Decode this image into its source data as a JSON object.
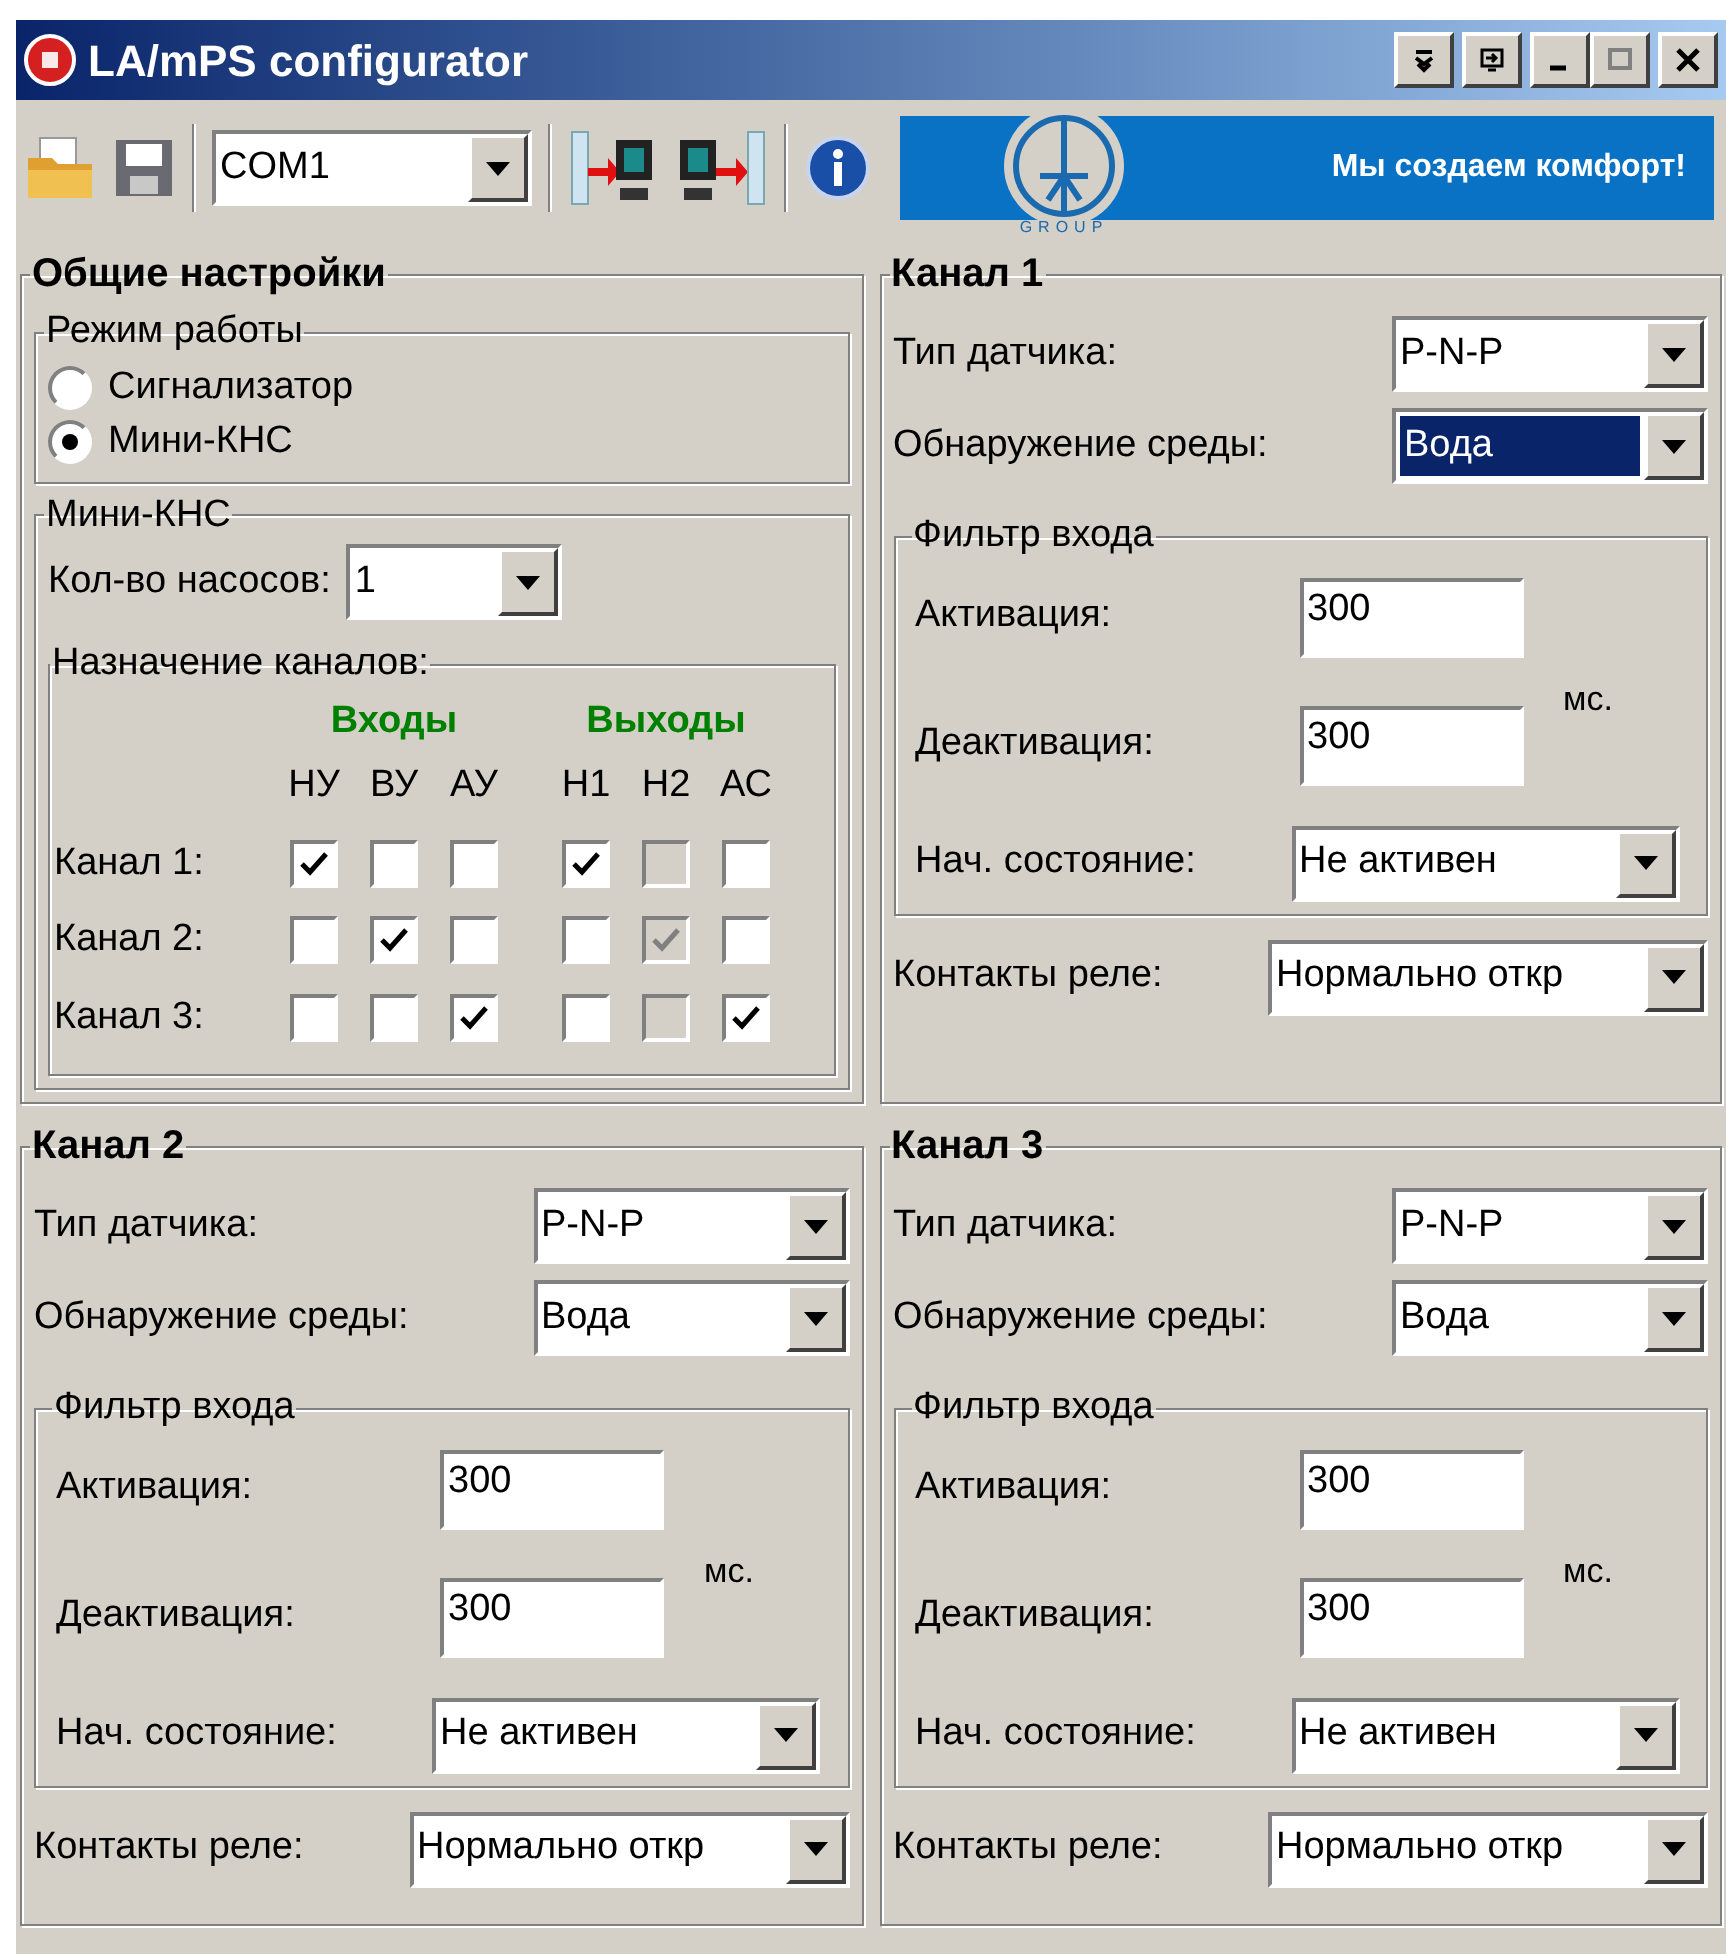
{
  "window": {
    "title": "LA/mPS configurator"
  },
  "toolbar": {
    "port": "COM1",
    "banner": {
      "caption": "GROUP",
      "slogan": "Мы создаем комфорт!"
    }
  },
  "general": {
    "title": "Общие настройки",
    "mode": {
      "title": "Режим работы",
      "options": [
        {
          "label": "Сигнализатор",
          "selected": false
        },
        {
          "label": "Мини-КНС",
          "selected": true
        }
      ]
    },
    "mini_kns": {
      "title": "Мини-КНС",
      "pumps_label": "Кол-во насосов:",
      "pumps": "1",
      "assignment": {
        "title": "Назначение каналов:",
        "groups": [
          "Входы",
          "Выходы"
        ],
        "columns": [
          "НУ",
          "ВУ",
          "АУ",
          "Н1",
          "Н2",
          "АС"
        ],
        "rows": [
          {
            "label": "Канал 1:",
            "cells": [
              {
                "checked": true,
                "disabled": false
              },
              {
                "checked": false,
                "disabled": false
              },
              {
                "checked": false,
                "disabled": false
              },
              {
                "checked": true,
                "disabled": false
              },
              {
                "checked": false,
                "disabled": true
              },
              {
                "checked": false,
                "disabled": false
              }
            ]
          },
          {
            "label": "Канал 2:",
            "cells": [
              {
                "checked": false,
                "disabled": false
              },
              {
                "checked": true,
                "disabled": false
              },
              {
                "checked": false,
                "disabled": false
              },
              {
                "checked": false,
                "disabled": false
              },
              {
                "checked": true,
                "disabled": true
              },
              {
                "checked": false,
                "disabled": false
              }
            ]
          },
          {
            "label": "Канал 3:",
            "cells": [
              {
                "checked": false,
                "disabled": false
              },
              {
                "checked": false,
                "disabled": false
              },
              {
                "checked": true,
                "disabled": false
              },
              {
                "checked": false,
                "disabled": false
              },
              {
                "checked": false,
                "disabled": true
              },
              {
                "checked": true,
                "disabled": false
              }
            ]
          }
        ]
      }
    }
  },
  "channels": [
    {
      "title": "Канал 1",
      "sensor_label": "Тип датчика:",
      "sensor": "P-N-P",
      "medium_label": "Обнаружение среды:",
      "medium": "Вода",
      "medium_focused": true,
      "filter_title": "Фильтр входа",
      "activation_label": "Активация:",
      "activation": "300",
      "deactivation_label": "Деактивация:",
      "deactivation": "300",
      "unit": "мс.",
      "initial_label": "Нач. состояние:",
      "initial": "Не активен",
      "relay_label": "Контакты реле:",
      "relay": "Нормально откр"
    },
    {
      "title": "Канал 2",
      "sensor_label": "Тип датчика:",
      "sensor": "P-N-P",
      "medium_label": "Обнаружение среды:",
      "medium": "Вода",
      "medium_focused": false,
      "filter_title": "Фильтр входа",
      "activation_label": "Активация:",
      "activation": "300",
      "deactivation_label": "Деактивация:",
      "deactivation": "300",
      "unit": "мс.",
      "initial_label": "Нач. состояние:",
      "initial": "Не активен",
      "relay_label": "Контакты реле:",
      "relay": "Нормально откр"
    },
    {
      "title": "Канал 3",
      "sensor_label": "Тип датчика:",
      "sensor": "P-N-P",
      "medium_label": "Обнаружение среды:",
      "medium": "Вода",
      "medium_focused": false,
      "filter_title": "Фильтр входа",
      "activation_label": "Активация:",
      "activation": "300",
      "deactivation_label": "Деактивация:",
      "deactivation": "300",
      "unit": "мс.",
      "initial_label": "Нач. состояние:",
      "initial": "Не активен",
      "relay_label": "Контакты реле:",
      "relay": "Нормально откр"
    }
  ]
}
